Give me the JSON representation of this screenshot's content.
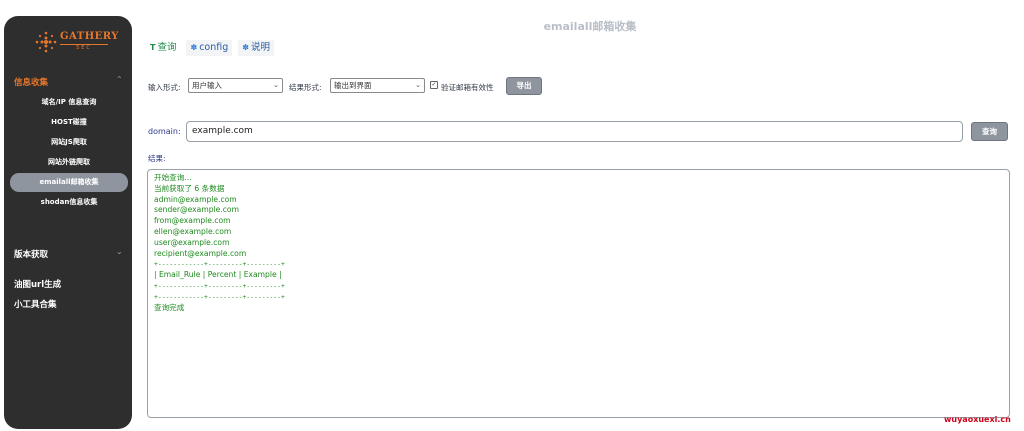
{
  "window": {
    "title": "emailall邮箱收集"
  },
  "sidebar": {
    "logo_text": "GATHERY",
    "logo_sub": "SEC",
    "groups": [
      {
        "label": "信息收集",
        "items": [
          {
            "label": "域名/IP 信息查询"
          },
          {
            "label": "HOST碰撞"
          },
          {
            "label": "网站JS爬取"
          },
          {
            "label": "网站外链爬取"
          },
          {
            "label": "emailall邮箱收集"
          },
          {
            "label": "shodan信息收集"
          }
        ]
      },
      {
        "label": "版本获取"
      },
      {
        "label": "油图url生成"
      },
      {
        "label": "小工具合集"
      }
    ],
    "selected_item": "emailall邮箱收集"
  },
  "tabs": [
    {
      "label": "查询",
      "icon": "T"
    },
    {
      "label": "config",
      "icon": "gear-icon"
    },
    {
      "label": "说明",
      "icon": "gear-icon"
    }
  ],
  "form": {
    "input_mode_label": "输入形式:",
    "input_mode_value": "用户输入",
    "result_mode_label": "结果形式:",
    "result_mode_value": "输出到界面",
    "validate_label": "验证邮箱有效性",
    "export_label": "导出",
    "domain_label": "domain:",
    "domain_value": "example.com",
    "query_label": "查询",
    "result_label": "结果:"
  },
  "result": {
    "lines": [
      "开始查询...",
      "当前获取了 6 条数据",
      "admin@example.com",
      "sender@example.com",
      "from@example.com",
      "ellen@example.com",
      "user@example.com",
      "recipient@example.com"
    ],
    "table_border": "+------------+---------+---------+",
    "table_header": "| Email_Rule | Percent | Example |",
    "done": "查询完成"
  },
  "watermark": "wuyaoxuexi.cn",
  "colors": {
    "sidebar_bg": "#2e2e2e",
    "accent": "#e7762a",
    "result_text": "#1f8a1f",
    "button": "#8e959e"
  }
}
